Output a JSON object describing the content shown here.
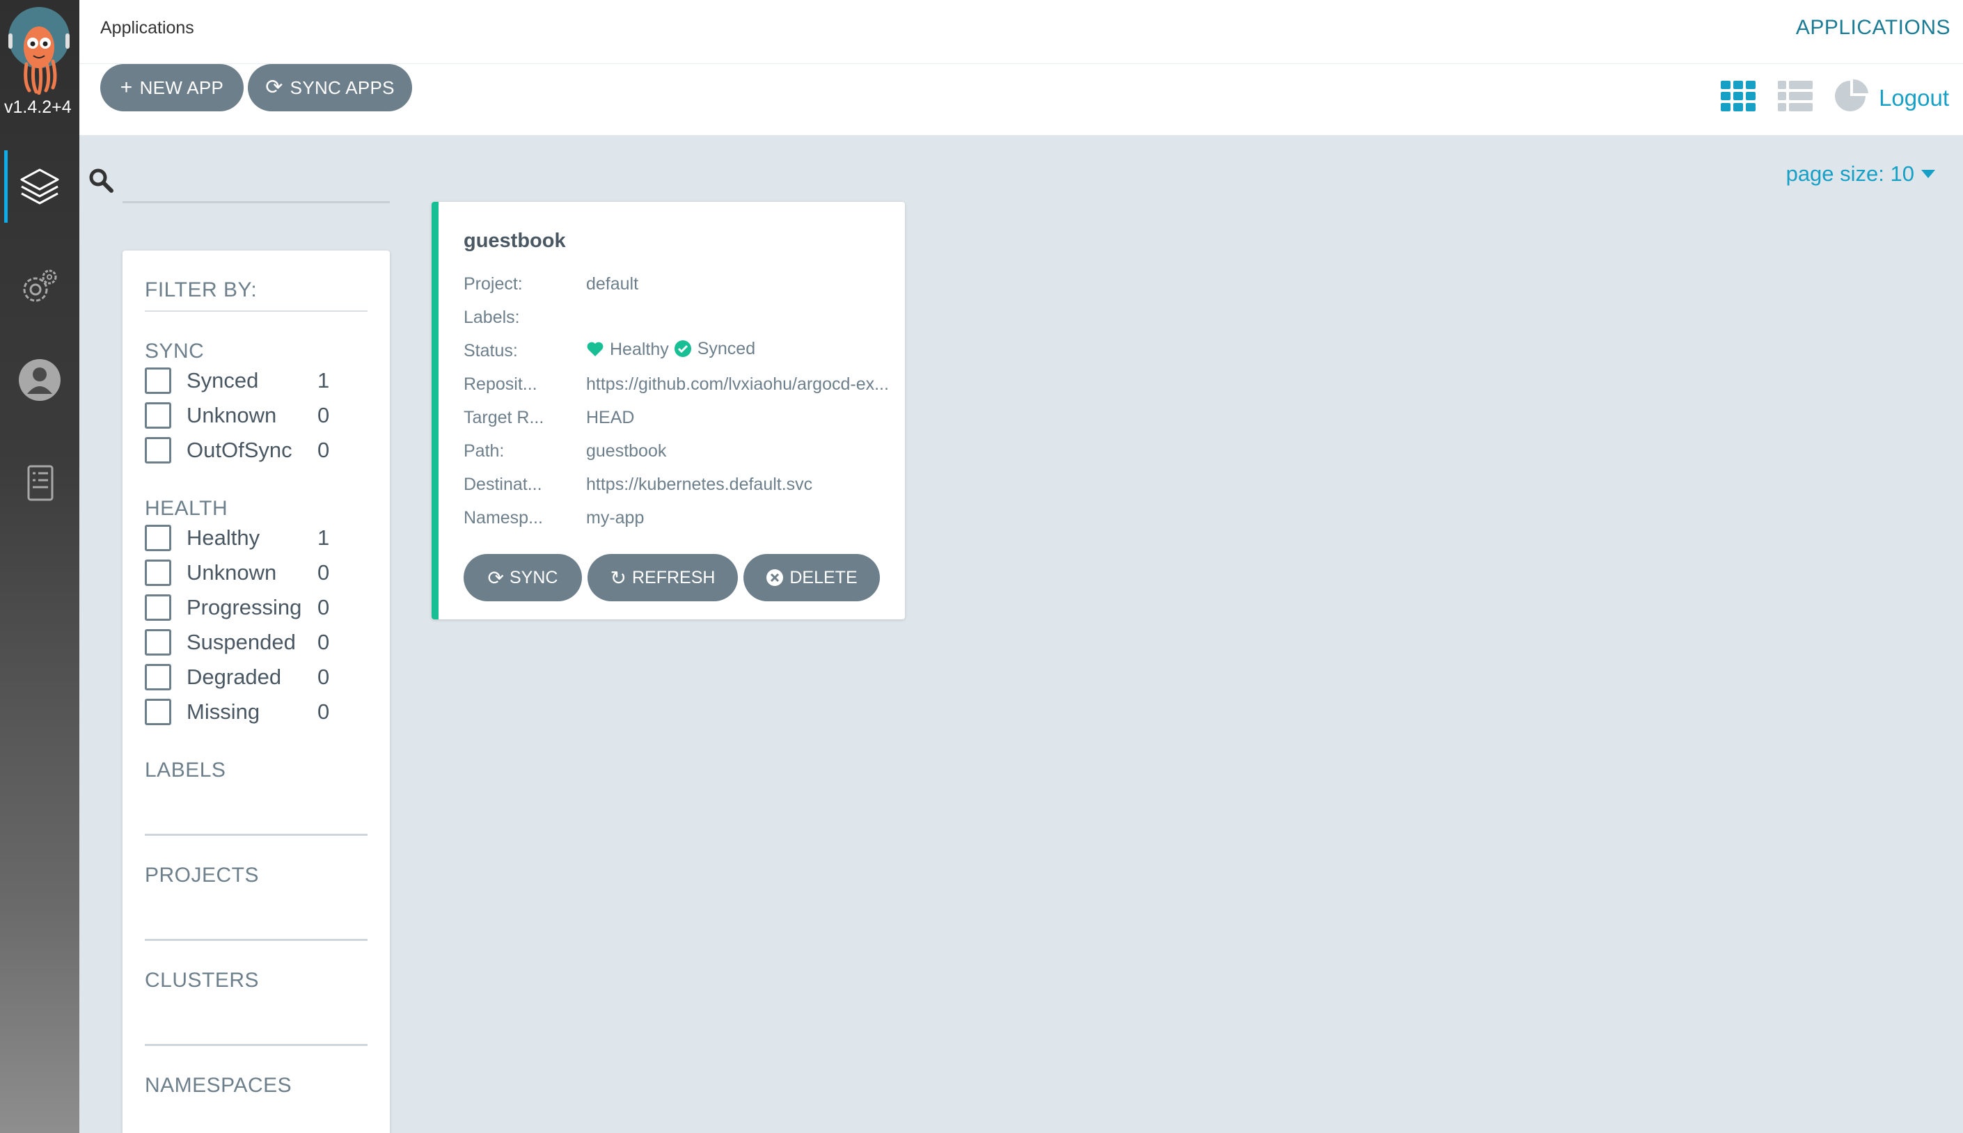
{
  "sidebar": {
    "version": "v1.4.2+4",
    "nav": [
      {
        "name": "applications",
        "icon": "layers-icon"
      },
      {
        "name": "settings",
        "icon": "gear-icon"
      },
      {
        "name": "user-info",
        "icon": "user-icon"
      },
      {
        "name": "documentation",
        "icon": "book-icon"
      }
    ]
  },
  "header": {
    "breadcrumb": "Applications",
    "title": "APPLICATIONS"
  },
  "toolbar": {
    "new_app": "NEW APP",
    "sync_apps": "SYNC APPS",
    "logout": "Logout",
    "views": [
      "tiles-view-icon",
      "list-view-icon",
      "summary-view-icon"
    ]
  },
  "search": {
    "value": "",
    "placeholder": ""
  },
  "pagination": {
    "page_size_label": "page size: 10"
  },
  "filters": {
    "title": "FILTER BY:",
    "sync": {
      "title": "SYNC",
      "items": [
        {
          "label": "Synced",
          "count": "1"
        },
        {
          "label": "Unknown",
          "count": "0"
        },
        {
          "label": "OutOfSync",
          "count": "0"
        }
      ]
    },
    "health": {
      "title": "HEALTH",
      "items": [
        {
          "label": "Healthy",
          "count": "1"
        },
        {
          "label": "Unknown",
          "count": "0"
        },
        {
          "label": "Progressing",
          "count": "0"
        },
        {
          "label": "Suspended",
          "count": "0"
        },
        {
          "label": "Degraded",
          "count": "0"
        },
        {
          "label": "Missing",
          "count": "0"
        }
      ]
    },
    "labels_title": "LABELS",
    "projects_title": "PROJECTS",
    "clusters_title": "CLUSTERS",
    "namespaces_title": "NAMESPACES"
  },
  "app": {
    "name": "guestbook",
    "fields": {
      "project_key": "Project:",
      "project": "default",
      "labels_key": "Labels:",
      "labels": "",
      "status_key": "Status:",
      "health": "Healthy",
      "sync": "Synced",
      "repo_key": "Reposit...",
      "repo": "https://github.com/lvxiaohu/argocd-ex...",
      "target_key": "Target R...",
      "target": "HEAD",
      "path_key": "Path:",
      "path": "guestbook",
      "dest_key": "Destinat...",
      "dest": "https://kubernetes.default.svc",
      "ns_key": "Namesp...",
      "ns": "my-app"
    },
    "actions": {
      "sync": "SYNC",
      "refresh": "REFRESH",
      "delete": "DELETE"
    },
    "status_color": "#18be94"
  },
  "colors": {
    "accent": "#17a0c6",
    "button": "#6d7f8b",
    "healthy": "#18be94"
  }
}
